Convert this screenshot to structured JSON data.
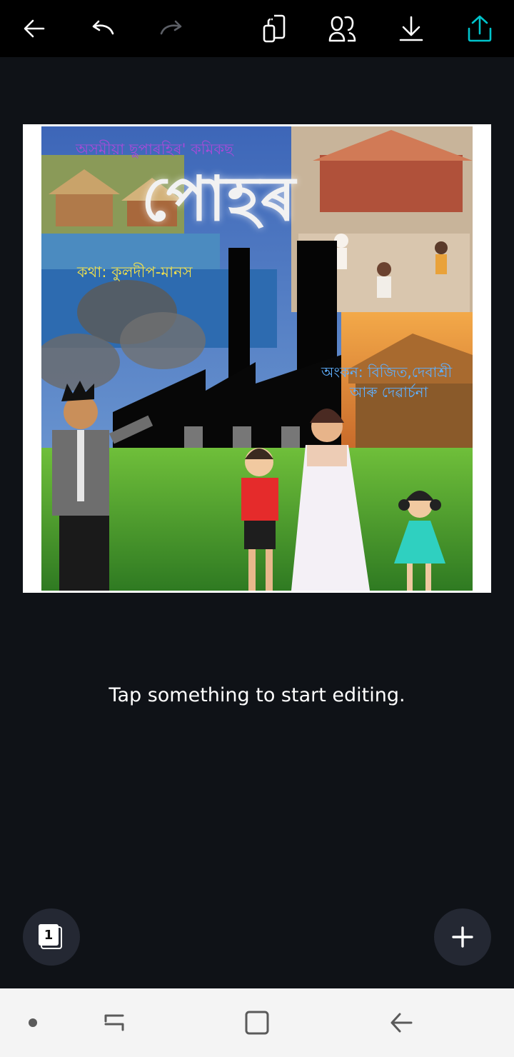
{
  "toolbar": {
    "back_icon": "arrow-left-icon",
    "undo_icon": "undo-icon",
    "redo_icon": "redo-icon",
    "copy_icon": "duplicate-icon",
    "collab_icon": "people-icon",
    "download_icon": "download-icon",
    "share_icon": "share-upload-icon",
    "colors": {
      "icon": "#ffffff",
      "disabled": "#5c5f66",
      "accent": "#00c4cc"
    }
  },
  "design": {
    "series_line": "অসমীয়া ছুপাৰহিৰ' কমিকছ",
    "title": "পোহৰ",
    "story_credit": "কথা: কুলদীপ-মানস",
    "art_credit_line1": "অংকন: বিজিত,দেবাশ্ৰী",
    "art_credit_line2": "আৰু দেৱাৰ্চনা"
  },
  "hint": "Tap something to start editing.",
  "pages": {
    "count": "1",
    "icon": "pages-icon"
  },
  "add": {
    "icon": "plus-icon"
  },
  "system_nav": {
    "dot_icon": "dot-icon",
    "recents_icon": "recent-apps-icon",
    "home_icon": "home-icon",
    "back_icon": "back-icon"
  }
}
